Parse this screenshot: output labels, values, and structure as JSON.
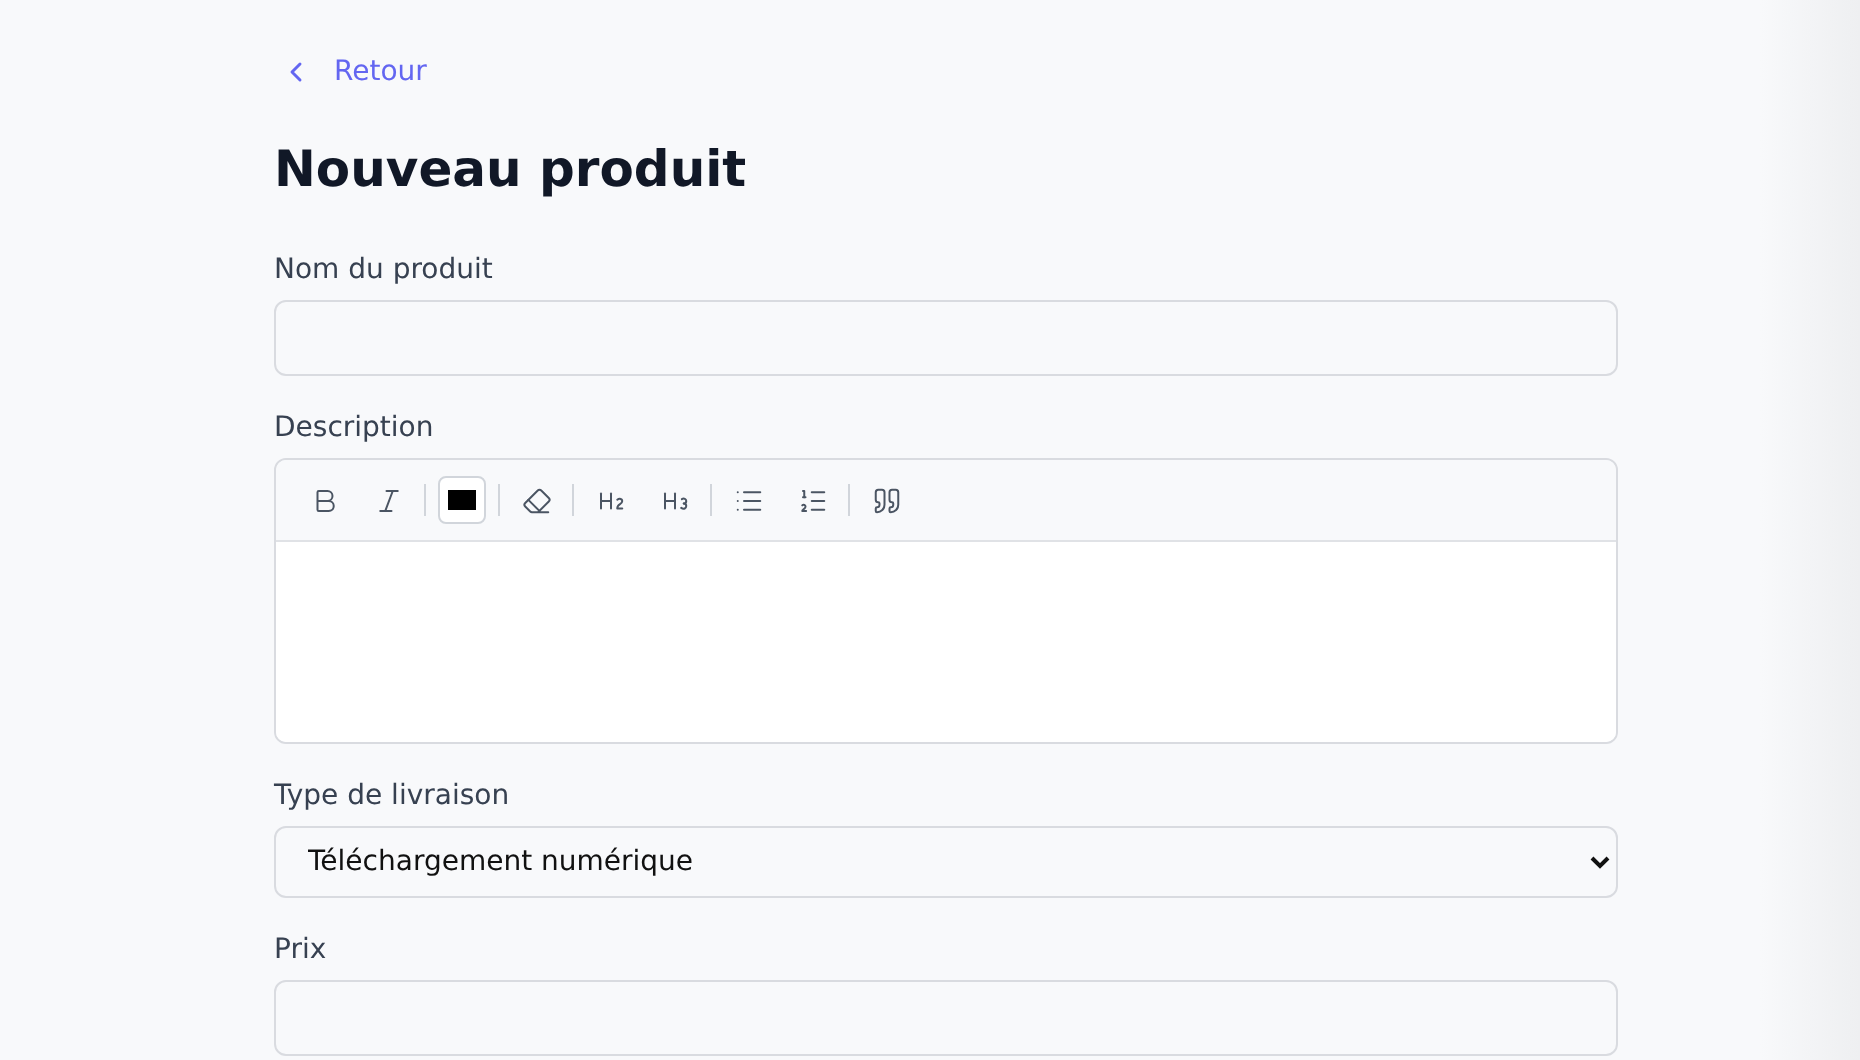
{
  "back_link": "Retour",
  "title": "Nouveau produit",
  "fields": [
    {
      "kind": "text",
      "label": "Nom du produit"
    },
    {
      "kind": "editor",
      "label": "Description",
      "color": "#000000"
    },
    {
      "kind": "select",
      "label": "Type de livraison",
      "value": "Téléchargement numérique"
    },
    {
      "kind": "text",
      "label": "Prix"
    }
  ]
}
